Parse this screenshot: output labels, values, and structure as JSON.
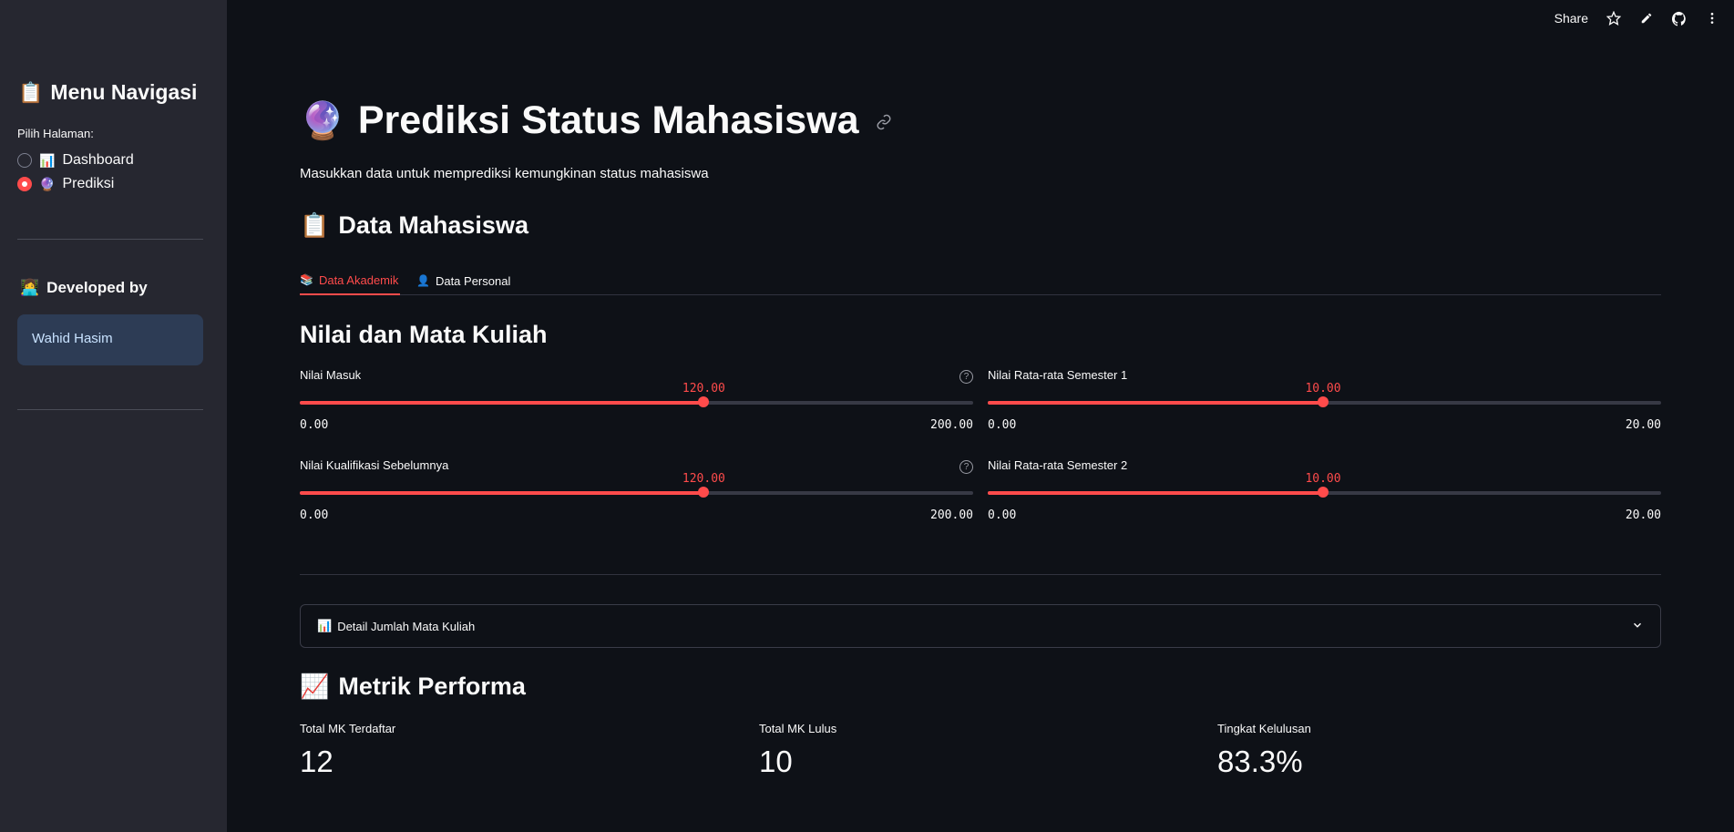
{
  "header": {
    "share_label": "Share",
    "icons": [
      "star-icon",
      "edit-icon",
      "github-icon",
      "more-vertical-icon"
    ]
  },
  "sidebar": {
    "title_emoji": "📋",
    "title": "Menu Navigasi",
    "radio_label": "Pilih Halaman:",
    "options": [
      {
        "emoji": "📊",
        "label": "Dashboard",
        "selected": false
      },
      {
        "emoji": "🔮",
        "label": "Prediksi",
        "selected": true
      }
    ],
    "developer_heading_emoji": "👩‍💻",
    "developer_heading": "Developed by",
    "developer_name": "Wahid Hasim"
  },
  "main": {
    "title_emoji": "🔮",
    "title": "Prediksi Status Mahasiswa",
    "subtitle": "Masukkan data untuk memprediksi kemungkinan status mahasiswa",
    "section_emoji": "📋",
    "section_title": "Data Mahasiswa",
    "tabs": [
      {
        "emoji": "📚",
        "label": "Data Akademik",
        "active": true
      },
      {
        "emoji": "👤",
        "label": "Data Personal",
        "active": false
      }
    ],
    "subsection_title": "Nilai dan Mata Kuliah",
    "sliders": [
      {
        "label": "Nilai Masuk",
        "value": "120.00",
        "min": "0.00",
        "max": "200.00",
        "fraction": 0.6,
        "help": true
      },
      {
        "label": "Nilai Rata-rata Semester 1",
        "value": "10.00",
        "min": "0.00",
        "max": "20.00",
        "fraction": 0.5,
        "help": false
      },
      {
        "label": "Nilai Kualifikasi Sebelumnya",
        "value": "120.00",
        "min": "0.00",
        "max": "200.00",
        "fraction": 0.6,
        "help": true
      },
      {
        "label": "Nilai Rata-rata Semester 2",
        "value": "10.00",
        "min": "0.00",
        "max": "20.00",
        "fraction": 0.5,
        "help": false
      }
    ],
    "expander_emoji": "📊",
    "expander_label": "Detail Jumlah Mata Kuliah",
    "metrics_emoji": "📈",
    "metrics_title": "Metrik Performa",
    "metrics": [
      {
        "label": "Total MK Terdaftar",
        "value": "12"
      },
      {
        "label": "Total MK Lulus",
        "value": "10"
      },
      {
        "label": "Tingkat Kelulusan",
        "value": "83.3%"
      }
    ]
  },
  "colors": {
    "accent": "#ff4b4b",
    "background": "#0e1117",
    "sidebar": "#262730"
  }
}
